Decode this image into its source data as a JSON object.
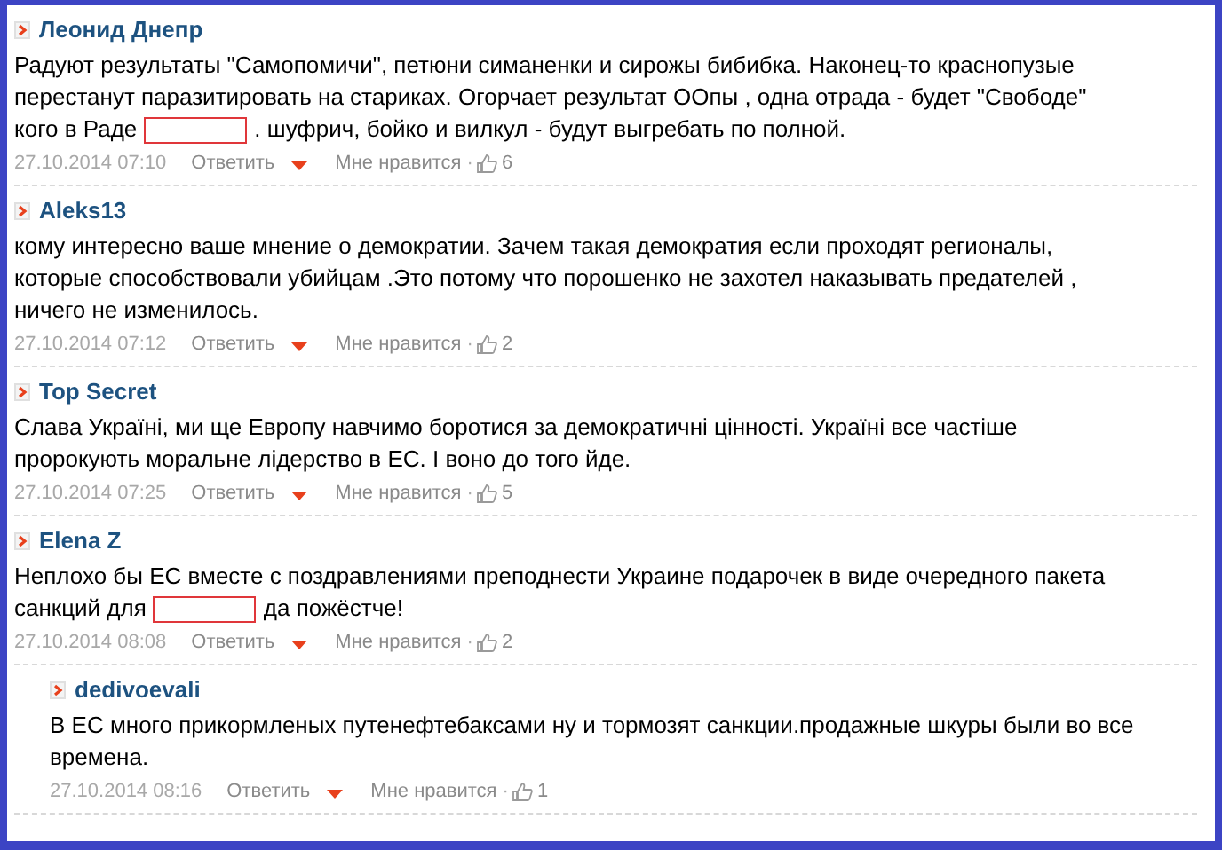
{
  "comments": [
    {
      "author": "Леонид Днепр",
      "lines": [
        [
          {
            "kind": "text",
            "text": "Радуют результаты \"Самопомичи\", петюни симаненки и сирожы бибибка. Наконец-то краснопузые"
          }
        ],
        [
          {
            "kind": "text",
            "text": "перестанут паразитировать на стариках. Огорчает результат ООпы , одна отрада - будет \"Свободе\""
          }
        ],
        [
          {
            "kind": "text",
            "text": "кого в Раде"
          },
          {
            "kind": "redaction"
          },
          {
            "kind": "text",
            "text": ". шуфрич, бойко и вилкул - будут выгребать по полной."
          }
        ]
      ],
      "date": "27.10.2014 07:10",
      "reply_label": "Ответить",
      "like_label": "Мне нравится",
      "dot": "·",
      "likes": "6"
    },
    {
      "author": "Aleks13",
      "lines": [
        [
          {
            "kind": "text",
            "text": "кому интересно ваше мнение о демократии. Зачем такая демократия если проходят регионалы,"
          }
        ],
        [
          {
            "kind": "text",
            "text": "которые способствовали убийцам .Это потому что порошенко не захотел наказывать предателей ,"
          }
        ],
        [
          {
            "kind": "text",
            "text": "ничего не изменилось."
          }
        ]
      ],
      "date": "27.10.2014 07:12",
      "reply_label": "Ответить",
      "like_label": "Мне нравится",
      "dot": "·",
      "likes": "2"
    },
    {
      "author": "Top Secret",
      "lines": [
        [
          {
            "kind": "text",
            "text": "Слава Україні, ми ще Европу навчимо боротися за демократичні цінності. Україні все частіше"
          }
        ],
        [
          {
            "kind": "text",
            "text": "пророкують моральне лідерство в ЕС. І воно до того йде."
          }
        ]
      ],
      "date": "27.10.2014 07:25",
      "reply_label": "Ответить",
      "like_label": "Мне нравится",
      "dot": "·",
      "likes": "5"
    },
    {
      "author": "Elena Z",
      "lines": [
        [
          {
            "kind": "text",
            "text": "Неплохо бы ЕС вместе с поздравлениями преподнести Украине подарочек в виде очередного пакета"
          }
        ],
        [
          {
            "kind": "text",
            "text": "санкций для"
          },
          {
            "kind": "redaction"
          },
          {
            "kind": "text",
            "text": "да пожёстче!"
          }
        ]
      ],
      "date": "27.10.2014 08:08",
      "reply_label": "Ответить",
      "like_label": "Мне нравится",
      "dot": "·",
      "likes": "2",
      "children": [
        {
          "author": "dedivoevali",
          "lines": [
            [
              {
                "kind": "text",
                "text": "В ЕС много прикормленых путенефтебаксами ну и тормозят санкции.продажные шкуры были во все"
              }
            ],
            [
              {
                "kind": "text",
                "text": "времена."
              }
            ]
          ],
          "date": "27.10.2014 08:16",
          "reply_label": "Ответить",
          "like_label": "Мне нравится",
          "dot": "·",
          "likes": "1"
        }
      ]
    }
  ]
}
